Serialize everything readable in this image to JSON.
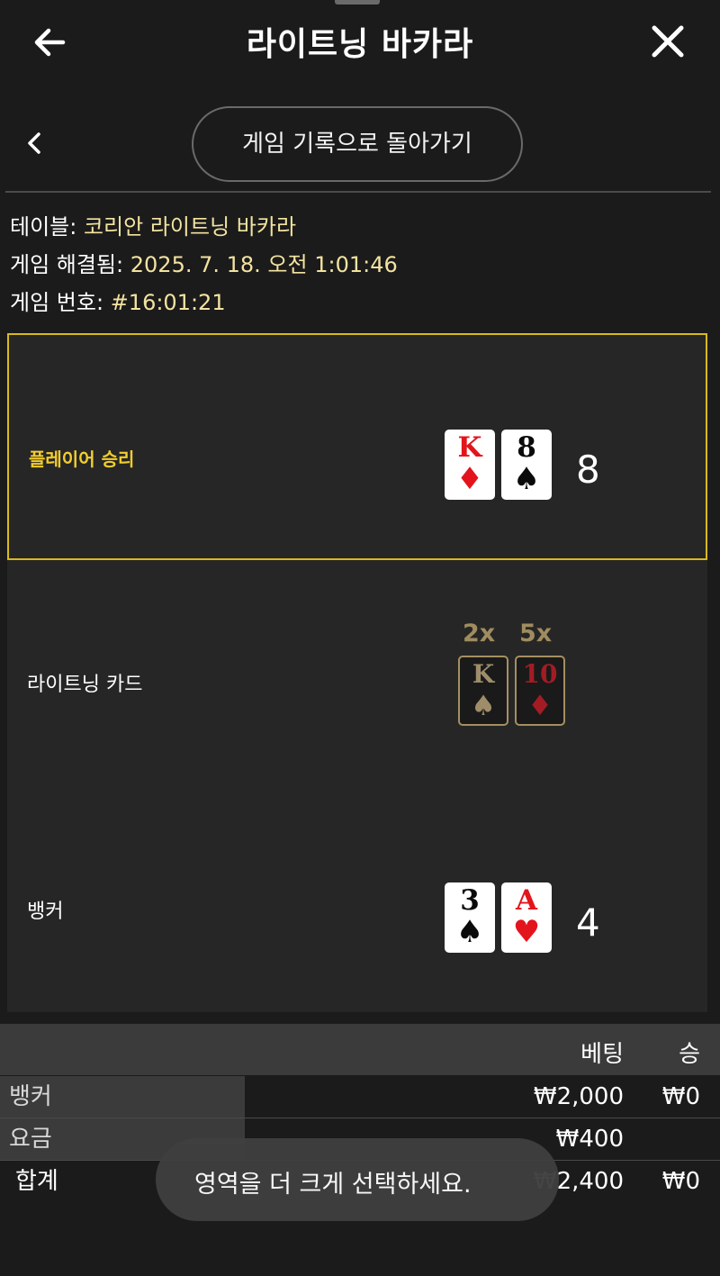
{
  "header": {
    "title": "라이트닝 바카라",
    "back_icon": "arrow-left-icon",
    "close_icon": "close-icon"
  },
  "nav": {
    "back_icon": "chevron-left-icon",
    "history_button": "게임 기록으로 돌아가기"
  },
  "info": {
    "table_label": "테이블:",
    "table_value": "코리안 라이트닝 바카라",
    "resolved_label": "게임 해결됨:",
    "resolved_value": "2025. 7. 18. 오전 1:01:46",
    "number_label": "게임 번호:",
    "number_value": "#16:01:21"
  },
  "player": {
    "label": "플레이어 승리",
    "cards": [
      {
        "rank": "K",
        "suit": "♦",
        "color": "#e3141c"
      },
      {
        "rank": "8",
        "suit": "♠",
        "color": "#0a0a0a"
      }
    ],
    "score": "8"
  },
  "lightning": {
    "label": "라이트닝 카드",
    "cards": [
      {
        "multiplier": "2x",
        "rank": "K",
        "suit": "♠"
      },
      {
        "multiplier": "5x",
        "rank": "10",
        "suit": "♦"
      }
    ]
  },
  "banker": {
    "label": "뱅커",
    "cards": [
      {
        "rank": "3",
        "suit": "♠",
        "color": "#0a0a0a"
      },
      {
        "rank": "A",
        "suit": "♥",
        "color": "#e3141c"
      }
    ],
    "score": "4"
  },
  "bets": {
    "header_bet": "베팅",
    "header_win": "승",
    "rows": [
      {
        "label": "뱅커",
        "bet": "₩2,000",
        "win": "₩0"
      },
      {
        "label": "요금",
        "bet": "₩400",
        "win": ""
      }
    ],
    "total_label": "합계",
    "total_bet": "₩2,400",
    "total_win": "₩0"
  },
  "toast": {
    "message": "영역을 더 크게 선택하세요."
  },
  "colors": {
    "accent_gold": "#d8b91f",
    "info_value": "#f3e3a1",
    "background": "#1b1b1b"
  }
}
